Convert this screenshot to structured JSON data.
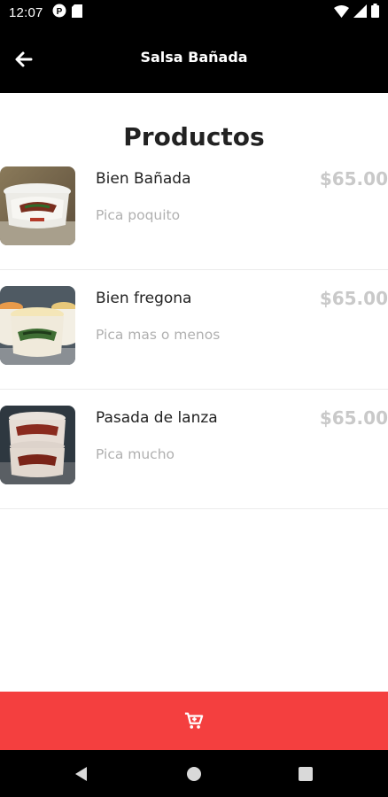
{
  "status_bar": {
    "time": "12:07"
  },
  "app_bar": {
    "title": "Salsa Bañada"
  },
  "section_title": "Productos",
  "products": [
    {
      "name": "Bien Bañada",
      "description": "Pica poquito",
      "price": "$65.00"
    },
    {
      "name": "Bien fregona",
      "description": "Pica mas o menos",
      "price": "$65.00"
    },
    {
      "name": "Pasada de lanza",
      "description": "Pica mucho",
      "price": "$65.00"
    }
  ],
  "colors": {
    "accent": "#f43f3f",
    "bar": "#000000",
    "price": "#c9c9c9",
    "muted": "#b0b0b0"
  }
}
